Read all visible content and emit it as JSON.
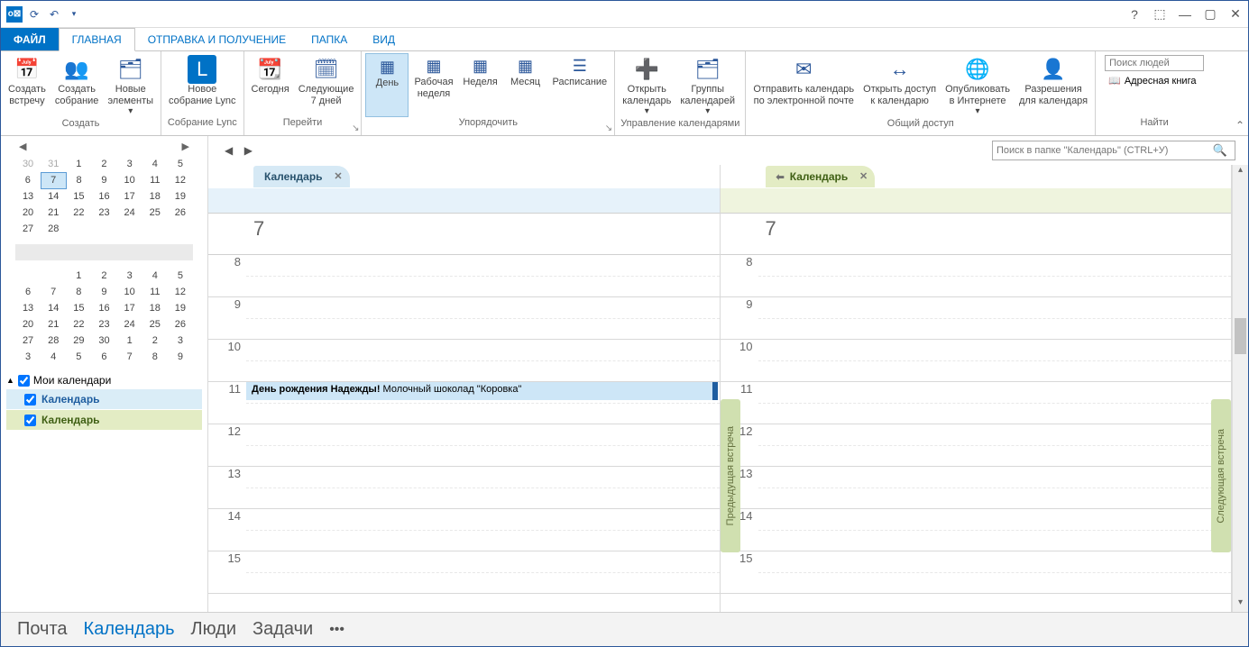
{
  "tabs": {
    "file": "ФАЙЛ",
    "home": "ГЛАВНАЯ",
    "sendreceive": "ОТПРАВКА И ПОЛУЧЕНИЕ",
    "folder": "ПАПКА",
    "view": "ВИД"
  },
  "ribbon": {
    "create": {
      "label": "Создать",
      "newappt": "Создать\nвстречу",
      "newmeeting": "Создать\nсобрание",
      "newitems": "Новые\nэлементы"
    },
    "lync": {
      "label": "Собрание Lync",
      "newlync": "Новое\nсобрание Lync"
    },
    "goto": {
      "label": "Перейти",
      "today": "Сегодня",
      "next7": "Следующие\n7 дней"
    },
    "arrange": {
      "label": "Упорядочить",
      "day": "День",
      "workweek": "Рабочая\nнеделя",
      "week": "Неделя",
      "month": "Месяц",
      "schedule": "Расписание"
    },
    "manage": {
      "label": "Управление календарями",
      "opencal": "Открыть\nкалендарь",
      "calgroups": "Группы\nкалендарей"
    },
    "share": {
      "label": "Общий доступ",
      "email": "Отправить календарь\nпо электронной почте",
      "access": "Открыть доступ\nк календарю",
      "publish": "Опубликовать\nв Интернете",
      "perms": "Разрешения\nдля календаря"
    },
    "find": {
      "label": "Найти",
      "placeholder": "Поиск людей",
      "addrbook": "Адресная книга"
    }
  },
  "minical1": {
    "weeks": [
      [
        "30",
        "31",
        "1",
        "2",
        "3",
        "4",
        "5"
      ],
      [
        "6",
        "7",
        "8",
        "9",
        "10",
        "11",
        "12"
      ],
      [
        "13",
        "14",
        "15",
        "16",
        "17",
        "18",
        "19"
      ],
      [
        "20",
        "21",
        "22",
        "23",
        "24",
        "25",
        "26"
      ],
      [
        "27",
        "28",
        "",
        "",
        "",
        "",
        ""
      ]
    ],
    "out_row": 0,
    "today": [
      1,
      1
    ]
  },
  "minical2": {
    "weeks": [
      [
        "",
        "",
        "1",
        "2",
        "3",
        "4",
        "5"
      ],
      [
        "6",
        "7",
        "8",
        "9",
        "10",
        "11",
        "12"
      ],
      [
        "13",
        "14",
        "15",
        "16",
        "17",
        "18",
        "19"
      ],
      [
        "20",
        "21",
        "22",
        "23",
        "24",
        "25",
        "26"
      ],
      [
        "27",
        "28",
        "29",
        "30",
        "1",
        "2",
        "3"
      ],
      [
        "3",
        "4",
        "5",
        "6",
        "7",
        "8",
        "9"
      ]
    ]
  },
  "calgroups": {
    "mycals": "Мои календари",
    "cal1": "Календарь",
    "cal2": "Календарь"
  },
  "search": {
    "placeholder": "Поиск в папке \"Календарь\" (CTRL+У)"
  },
  "pane1": {
    "tab": "Календарь",
    "daynum": "7"
  },
  "pane2": {
    "tab": "Календарь",
    "daynum": "7",
    "prev": "Предыдущая встреча",
    "next": "Следующая встреча"
  },
  "hours": [
    "8",
    "9",
    "10",
    "11",
    "12",
    "13",
    "14",
    "15"
  ],
  "event": {
    "bold": "День рождения Надежды!",
    "rest": " Молочный шоколад \"Коровка\""
  },
  "bottom": {
    "mail": "Почта",
    "calendar": "Календарь",
    "people": "Люди",
    "tasks": "Задачи"
  }
}
